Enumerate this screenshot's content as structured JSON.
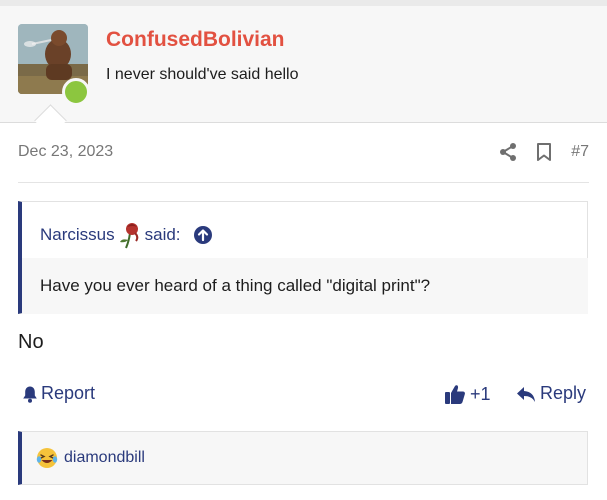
{
  "author": {
    "username": "ConfusedBolivian",
    "user_title": "I never should've said hello",
    "status": "online",
    "status_color": "#8cc63f",
    "username_color": "#e25141"
  },
  "post": {
    "date": "Dec 23, 2023",
    "number": "#7",
    "meta_icons": [
      "share-icon",
      "bookmark-icon"
    ],
    "body": "No"
  },
  "quote": {
    "author": "Narcissus",
    "author_icon": "wilted-rose-icon",
    "said_label": "said:",
    "jump_icon": "arrow-up-circle-icon",
    "text": "Have you ever heard of a thing called \"digital print\"?"
  },
  "actions": {
    "report_label": "Report",
    "like_count": "+1",
    "reply_label": "Reply"
  },
  "reactions": {
    "emoji": "laughing-crying-emoji",
    "users": "diamondbill"
  },
  "colors": {
    "accent": "#2a3a7c",
    "header_bg": "#f7f7f7",
    "muted_text": "#777777"
  }
}
